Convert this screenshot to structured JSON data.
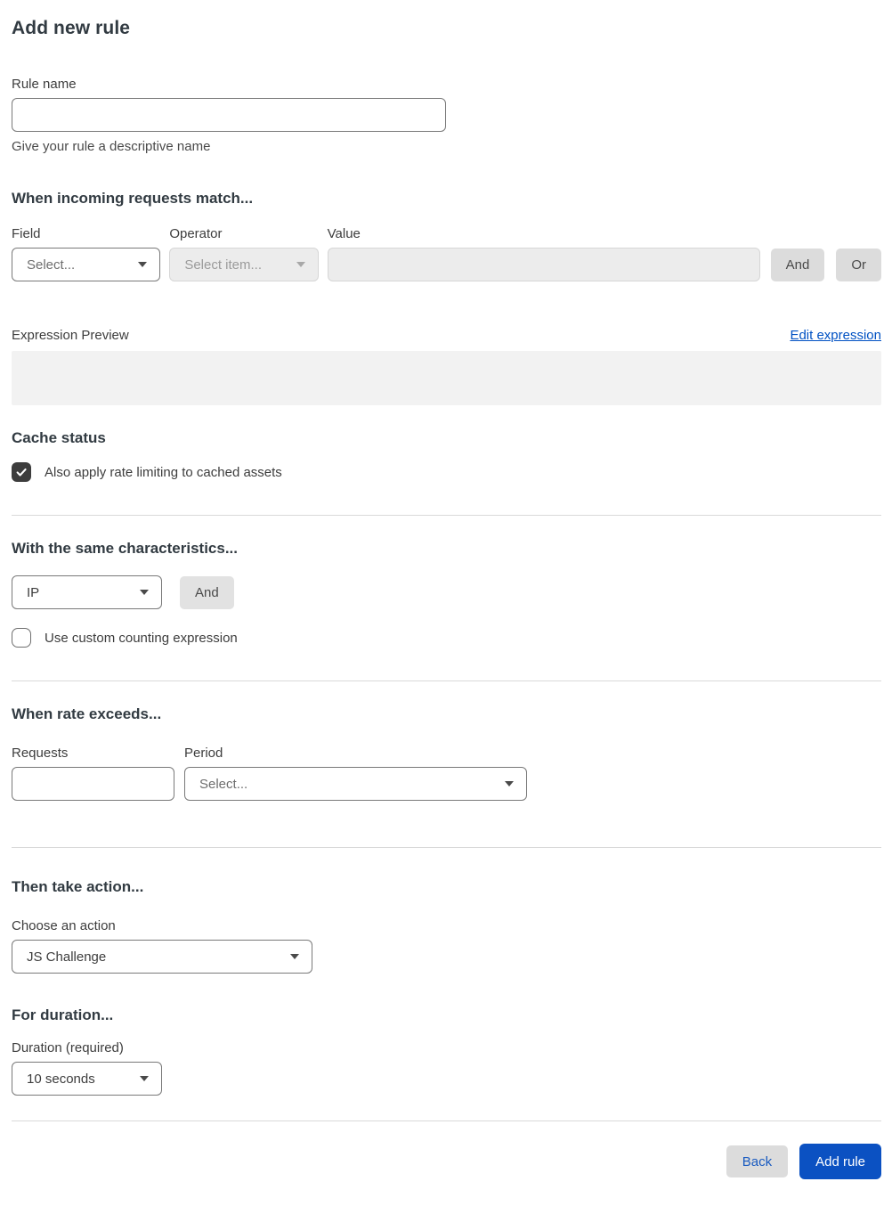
{
  "page": {
    "title": "Add new rule"
  },
  "rule_name": {
    "label": "Rule name",
    "value": "",
    "help": "Give your rule a descriptive name"
  },
  "match_section": {
    "heading": "When incoming requests match...",
    "field": {
      "label": "Field",
      "selected": "Select..."
    },
    "operator": {
      "label": "Operator",
      "selected": "Select item..."
    },
    "value": {
      "label": "Value",
      "value": ""
    },
    "and_label": "And",
    "or_label": "Or",
    "expression_preview_label": "Expression Preview",
    "edit_expression_label": "Edit expression",
    "expression_value": ""
  },
  "cache_status": {
    "heading": "Cache status",
    "checkbox_label": "Also apply rate limiting to cached assets",
    "checked": true
  },
  "characteristics": {
    "heading": "With the same characteristics...",
    "selected": "IP",
    "and_label": "And",
    "checkbox_label": "Use custom counting expression",
    "checked": false
  },
  "rate": {
    "heading": "When rate exceeds...",
    "requests_label": "Requests",
    "requests_value": "",
    "period_label": "Period",
    "period_selected": "Select..."
  },
  "action": {
    "heading": "Then take action...",
    "label": "Choose an action",
    "selected": "JS Challenge"
  },
  "duration": {
    "heading": "For duration...",
    "label": "Duration (required)",
    "selected": "10 seconds"
  },
  "footer": {
    "back_label": "Back",
    "submit_label": "Add rule"
  },
  "colors": {
    "accent_blue": "#0b51c2",
    "link_blue": "#0051c3",
    "checkbox_checked": "#3d3d3d",
    "divider": "#d9d9d9",
    "disabled_bg": "#ececec",
    "preview_bg": "#f2f2f2",
    "gray_button_bg": "#dcdcdc"
  }
}
